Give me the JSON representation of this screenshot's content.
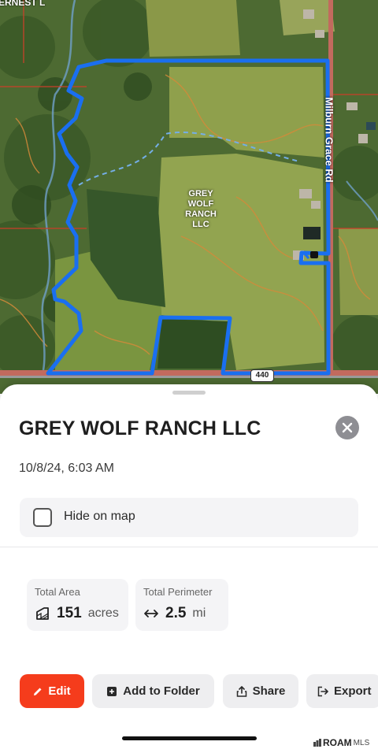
{
  "map": {
    "parcel_label_lines": [
      "GREY",
      "WOLF",
      "RANCH",
      "LLC"
    ],
    "road_label": "Milburn Grace Rd",
    "corner_road_label": "ERNEST L",
    "highway_shield": "440"
  },
  "sheet": {
    "title": "GREY WOLF RANCH LLC",
    "date": "10/8/24, 6:03 AM",
    "hide_on_map": {
      "label": "Hide on map",
      "checked": false
    },
    "stats": {
      "area": {
        "label": "Total Area",
        "value": "151",
        "unit": "acres",
        "icon": "area-icon"
      },
      "perimeter": {
        "label": "Total Perimeter",
        "value": "2.5",
        "unit": "mi",
        "icon": "double-arrow-icon"
      }
    },
    "actions": {
      "edit": "Edit",
      "add_folder": "Add to Folder",
      "share": "Share",
      "export": "Export"
    }
  },
  "brand": {
    "logo_main": "ROAM",
    "logo_sub": "MLS"
  },
  "colors": {
    "accent": "#f53c1c",
    "boundary": "#1a6ff0",
    "close": "#8e8e93"
  }
}
